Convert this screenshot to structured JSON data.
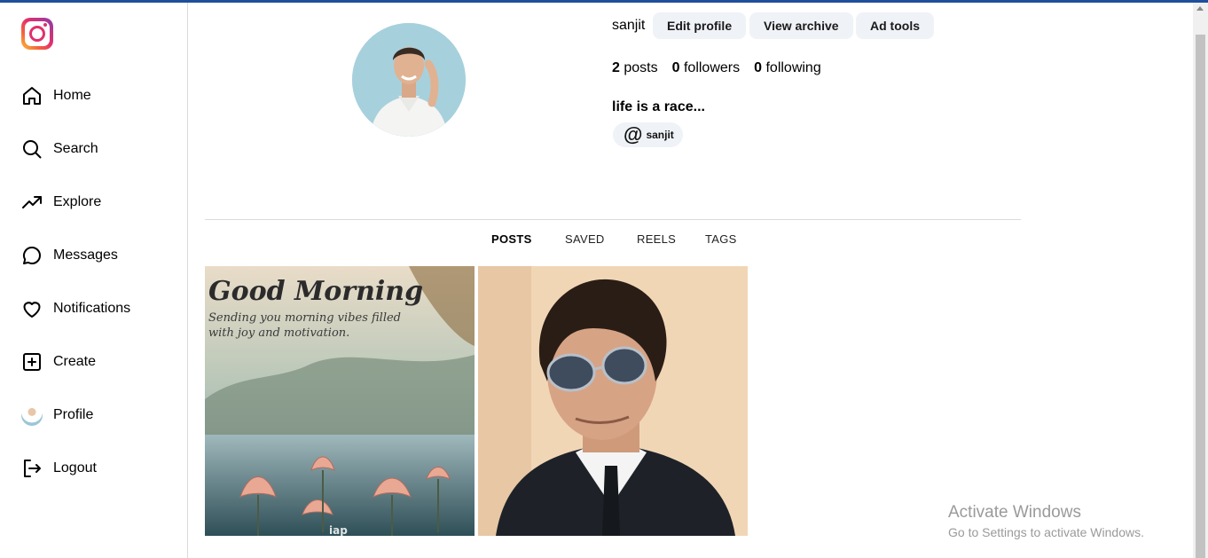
{
  "sidebar": {
    "logo_icon": "instagram-logo",
    "items": [
      {
        "label": "Home",
        "icon": "home-icon"
      },
      {
        "label": "Search",
        "icon": "search-icon"
      },
      {
        "label": "Explore",
        "icon": "trending-icon"
      },
      {
        "label": "Messages",
        "icon": "message-icon"
      },
      {
        "label": "Notifications",
        "icon": "heart-icon"
      },
      {
        "label": "Create",
        "icon": "plus-square-icon"
      },
      {
        "label": "Profile",
        "icon": "avatar"
      },
      {
        "label": "Logout",
        "icon": "logout-icon"
      }
    ]
  },
  "profile": {
    "username": "sanjit",
    "buttons": {
      "edit": "Edit profile",
      "archive": "View archive",
      "ad_tools": "Ad tools"
    },
    "stats": {
      "posts_count": "2",
      "posts_label": "posts",
      "followers_count": "0",
      "followers_label": "followers",
      "following_count": "0",
      "following_label": "following"
    },
    "bio": "life is a race...",
    "threads_handle": "sanjit"
  },
  "tabs": [
    {
      "label": "POSTS",
      "active": true
    },
    {
      "label": "SAVED",
      "active": false
    },
    {
      "label": "REELS",
      "active": false
    },
    {
      "label": "TAGS",
      "active": false
    }
  ],
  "posts": [
    {
      "title": "Good Morning",
      "caption": "Sending you morning vibes filled with joy and motivation.",
      "mark": "iap"
    },
    {
      "subject": "portrait"
    }
  ],
  "watermark": {
    "line1": "Activate Windows",
    "line2": "Go to Settings to activate Windows."
  }
}
